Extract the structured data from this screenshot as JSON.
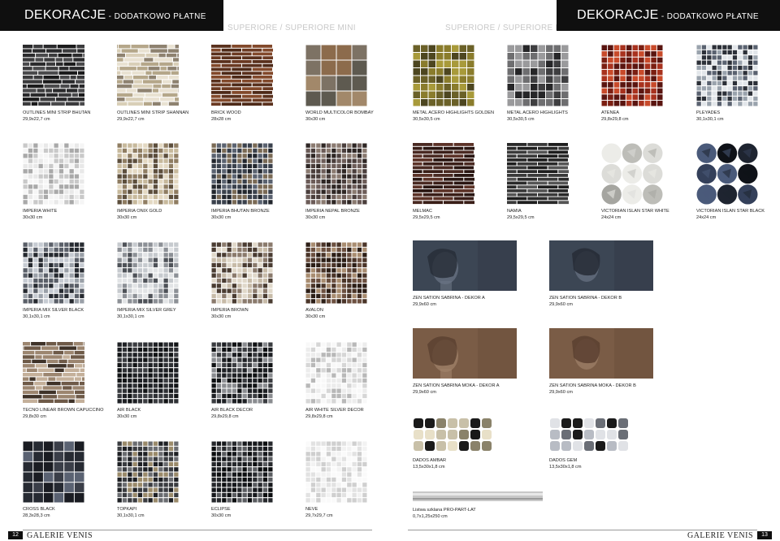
{
  "header": {
    "left": {
      "title": "DEKORACJE",
      "subtitle": " - DODATKOWO PŁATNE"
    },
    "right": {
      "title": "DEKORACJE",
      "subtitle": " - DODATKOWO PŁATNE"
    },
    "section_left": "SUPERIORE / SUPERIORE MINI",
    "section_right": "SUPERIORE / SUPERIORE MINI"
  },
  "products": [
    {
      "name": "OUTLINES MINI STRIP BHUTAN",
      "size": "29,9x22,7 cm",
      "pattern": "strip",
      "colors": [
        "#2a2a2c",
        "#3b3b3d",
        "#1b1b1c",
        "#4a4a4c"
      ]
    },
    {
      "name": "OUTLINES MINI STRIP SHANNAN",
      "size": "29,9x22,7 cm",
      "pattern": "strip",
      "colors": [
        "#d9cfb8",
        "#b5a78a",
        "#e9e2d2",
        "#8e8270"
      ]
    },
    {
      "name": "BRICK WOOD",
      "size": "28x28 cm",
      "pattern": "brick",
      "colors": [
        "#6b3a22",
        "#4e2a18",
        "#82492b",
        "#5a311d"
      ]
    },
    {
      "name": "WORLD MULTICOLOR BOMBAY",
      "size": "30x30 cm",
      "pattern": "grid4",
      "colors": [
        "#7d7264",
        "#8c6b4c",
        "#5e5a50",
        "#a2886a"
      ]
    },
    {
      "name": "METAL ACERO HIGHLIGHTS GOLDEN",
      "size": "30,5x30,5 cm",
      "pattern": "grid8",
      "colors": [
        "#8a7c2c",
        "#6b6128",
        "#a89a3a",
        "#4d4620"
      ]
    },
    {
      "name": "METAL ACERO HIGHLIGHTS",
      "size": "30,5x30,5 cm",
      "pattern": "grid8",
      "colors": [
        "#6e6e70",
        "#3e3e40",
        "#9a9a9c",
        "#262628"
      ]
    },
    {
      "name": "ATENEA",
      "size": "29,8x29,8 cm",
      "pattern": "grid10",
      "colors": [
        "#a8321e",
        "#7b1f12",
        "#c84a2a",
        "#5a1510"
      ]
    },
    {
      "name": "PLEYADES",
      "size": "30,1x30,1 cm",
      "pattern": "grid12",
      "colors": [
        "#9aa3ad",
        "#2c3038",
        "#e2e6ea",
        "#5a6270"
      ]
    },
    {
      "name": "IMPERIA WHITE",
      "size": "30x30 cm",
      "pattern": "grid12",
      "colors": [
        "#e8e8e8",
        "#c9c9c9",
        "#f5f5f5",
        "#a9a9a9"
      ]
    },
    {
      "name": "IMPERIA ONIX GOLD",
      "size": "30x30 cm",
      "pattern": "grid12",
      "colors": [
        "#c7b99c",
        "#8f7d62",
        "#e3d8c2",
        "#5c4e3c"
      ]
    },
    {
      "name": "IMPERIA BHUTAN BRONZE",
      "size": "30x30 cm",
      "pattern": "grid12",
      "colors": [
        "#3a414c",
        "#5a6270",
        "#7a6a55",
        "#22262d"
      ]
    },
    {
      "name": "IMPERIA NEPAL BRONZE",
      "size": "30x30 cm",
      "pattern": "grid12",
      "colors": [
        "#6c5c58",
        "#4a3e3c",
        "#8a7a70",
        "#2e2624"
      ]
    },
    {
      "name": "MELMAC",
      "size": "29,5x29,5 cm",
      "pattern": "brick",
      "colors": [
        "#4a2a22",
        "#3a1e18",
        "#5c3328",
        "#2a1612"
      ]
    },
    {
      "name": "NAMIA",
      "size": "29,5x29,5 cm",
      "pattern": "brick",
      "colors": [
        "#3a3a3a",
        "#2a2a2a",
        "#555555",
        "#1e1e1e"
      ]
    },
    {
      "name": "VICTORIAN ISLAN STAR WHITE",
      "size": "24x24 cm",
      "pattern": "star",
      "colors": [
        "#dcdcd8",
        "#bdbdb8",
        "#ecece8",
        "#a5a5a0"
      ]
    },
    {
      "name": "VICTORIAN ISLAN STAR BLACK",
      "size": "24x24 cm",
      "pattern": "star",
      "colors": [
        "#1e2430",
        "#34405a",
        "#0f1218",
        "#4a5a7a"
      ]
    },
    {
      "name": "IMPERIA MIX SILVER BLACK",
      "size": "30,1x30,1 cm",
      "pattern": "grid12",
      "colors": [
        "#5a5f68",
        "#9aa0a8",
        "#262a30",
        "#c6cbd2"
      ]
    },
    {
      "name": "IMPERIA MIX SILVER GREY",
      "size": "30,1x30,1 cm",
      "pattern": "grid12",
      "colors": [
        "#8c9096",
        "#c6cace",
        "#4e5258",
        "#e2e4e6"
      ]
    },
    {
      "name": "IMPERIA BROWN",
      "size": "30x30 cm",
      "pattern": "grid12",
      "colors": [
        "#8a7a6c",
        "#c7bba8",
        "#4a3c32",
        "#e0d8ca"
      ]
    },
    {
      "name": "AVALON",
      "size": "30x30 cm",
      "pattern": "grid12",
      "colors": [
        "#4a3428",
        "#6c5040",
        "#2c1e16",
        "#a88c70"
      ]
    },
    {
      "name": "TECNO LINEAR BROWN CAPUCCINO",
      "size": "29,8x30 cm",
      "pattern": "strip",
      "colors": [
        "#6e5a48",
        "#9c8670",
        "#3e3228",
        "#c4b09a"
      ]
    },
    {
      "name": "AIR BLACK",
      "size": "30x30 cm",
      "pattern": "grid12",
      "colors": [
        "#1e2024",
        "#2e3034",
        "#121416",
        "#3a3c40"
      ]
    },
    {
      "name": "AIR BLACK DECOR",
      "size": "29,8x29,8 cm",
      "pattern": "grid12",
      "colors": [
        "#1e2024",
        "#3a3c40",
        "#101214",
        "#8a8c90"
      ]
    },
    {
      "name": "AIR WHITE SILVER DECOR",
      "size": "29,8x29,8 cm",
      "pattern": "grid12",
      "colors": [
        "#ececec",
        "#d6d6d6",
        "#f8f8f8",
        "#b8b8b8"
      ]
    },
    {
      "name": "CROSS BLACK",
      "size": "28,3x28,3 cm",
      "pattern": "grid6",
      "colors": [
        "#3a3e48",
        "#262a32",
        "#5a6272",
        "#1a1c22"
      ]
    },
    {
      "name": "TOPKAPI",
      "size": "30,1x30,1 cm",
      "pattern": "grid12",
      "colors": [
        "#3a3c40",
        "#1e2024",
        "#6a6c70",
        "#9a8a6a"
      ]
    },
    {
      "name": "ECLIPSE",
      "size": "30x30 cm",
      "pattern": "grid12",
      "colors": [
        "#16181c",
        "#26282c",
        "#0c0e10",
        "#5a5c60"
      ]
    },
    {
      "name": "NEVE",
      "size": "29,7x29,7 cm",
      "pattern": "grid12",
      "colors": [
        "#f2f2f2",
        "#e2e2e2",
        "#fafafa",
        "#cfcfcf"
      ]
    }
  ],
  "decors": [
    {
      "name": "ZEN SATION SABRINA - DEKOR A",
      "size": "29,9x60 cm",
      "colors": [
        "#3c4654",
        "#262c36",
        "#6a7484"
      ]
    },
    {
      "name": "ZEN SATION SABRINA - DEKOR B",
      "size": "29,9x60 cm",
      "colors": [
        "#3c4654",
        "#262c36",
        "#6a7484"
      ]
    },
    {
      "name": "ZEN SATION SABRINA MOKA - DEKOR A",
      "size": "29,9x60 cm",
      "colors": [
        "#7a5c46",
        "#5a4030",
        "#a0826a"
      ]
    },
    {
      "name": "ZEN SATION SABRINA MOKA - DEKOR B",
      "size": "29,9x60 cm",
      "colors": [
        "#7a5c46",
        "#5a4030",
        "#a0826a"
      ]
    }
  ],
  "dados": [
    {
      "name": "DADOS AMBAR",
      "size": "13,5x30x1,8 cm",
      "colors": [
        "#1a1a1a",
        "#c8c0a8",
        "#8a826a",
        "#e8e0c8"
      ]
    },
    {
      "name": "DADOS GEM",
      "size": "13,5x30x1,8 cm",
      "colors": [
        "#1a1a1a",
        "#b8bcc4",
        "#6a6e76",
        "#e0e2e6"
      ]
    }
  ],
  "listwa": {
    "name": "Listwa szklana PRO-PART-LAT",
    "size": "0,7x1,25x250 cm",
    "colors": [
      "#c8c8c8",
      "#e8e8e8",
      "#9a9a9a"
    ]
  },
  "footer": {
    "left_page": "12",
    "right_page": "13",
    "brand_left": "GALERIE VENIS",
    "brand_right": "GALERIE VENIS"
  }
}
